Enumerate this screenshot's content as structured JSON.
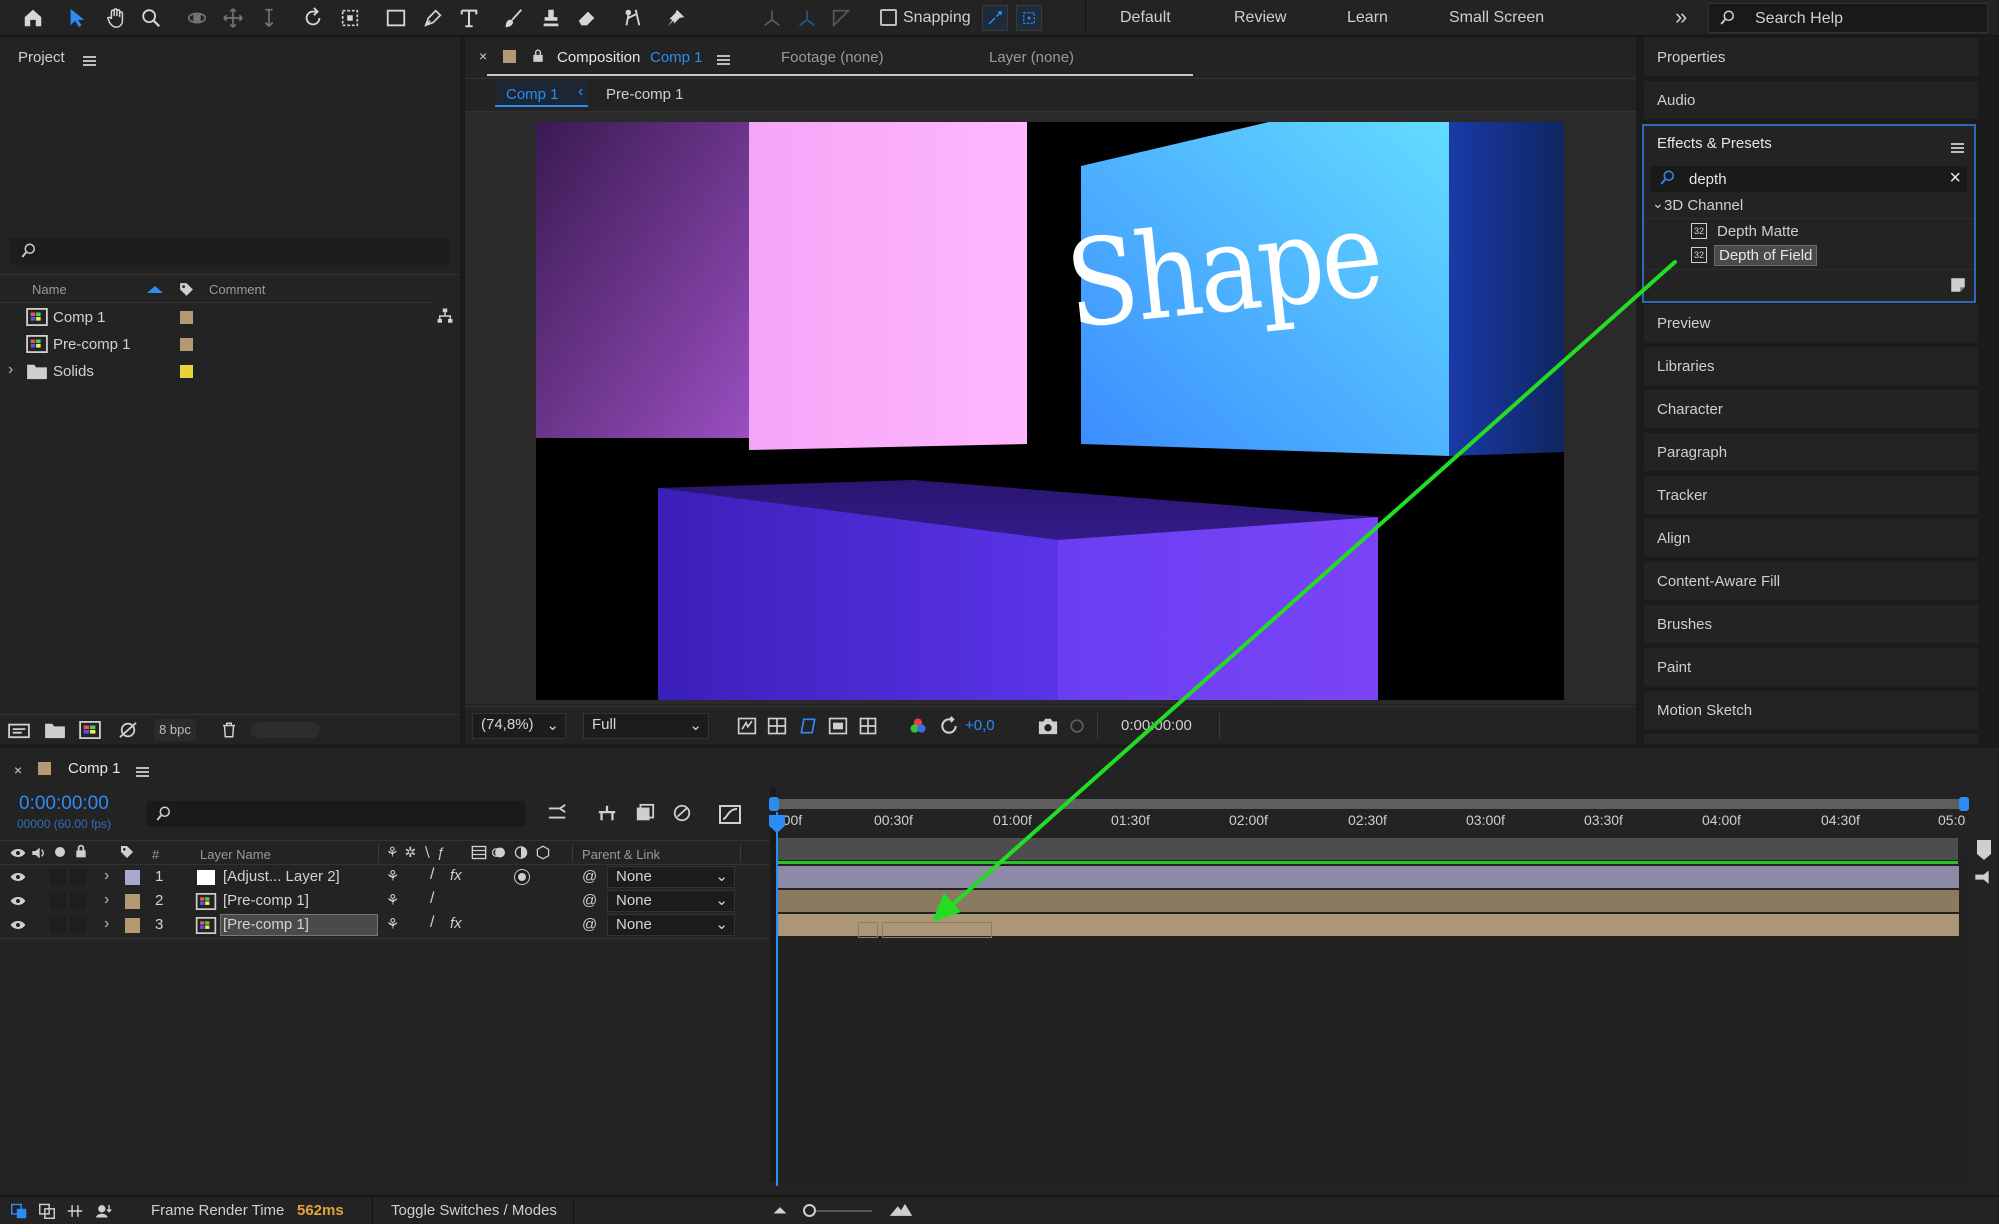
{
  "toolbar": {
    "tools": [
      "home-icon",
      "selection-icon",
      "hand-icon",
      "zoom-icon",
      "orbit-icon",
      "pan-icon",
      "dolly-icon",
      "rotate-icon",
      "camera-icon",
      "rectangle-icon",
      "pen-icon",
      "type-icon",
      "brush-icon",
      "clone-stamp-icon",
      "eraser-icon",
      "roto-brush-icon",
      "puppet-pin-icon"
    ],
    "snapping_label": "Snapping",
    "workspaces": [
      "Default",
      "Review",
      "Learn",
      "Small Screen"
    ],
    "overflow": "»",
    "search_placeholder": "Search Help"
  },
  "project": {
    "title": "Project",
    "search_value": "",
    "columns": {
      "name": "Name",
      "comment": "Comment"
    },
    "items": [
      {
        "name": "Comp 1",
        "type": "composition",
        "color": "#b39a72"
      },
      {
        "name": "Pre-comp 1",
        "type": "composition",
        "color": "#b39a72"
      },
      {
        "name": "Solids",
        "type": "folder",
        "color": "#e7d33a"
      }
    ],
    "bpc": "8 bpc"
  },
  "viewer": {
    "tab_prefix": "Composition",
    "tab_comp": "Comp 1",
    "footage_tab": "Footage (none)",
    "layer_tab": "Layer (none)",
    "breadcrumbs": [
      "Comp 1",
      "Pre-comp 1"
    ],
    "shape_text": "Shape",
    "zoom": "(74,8%)",
    "resolution": "Full",
    "exposure": "+0,0",
    "timecode": "0:00:00:00"
  },
  "right_panels": {
    "properties": "Properties",
    "audio": "Audio",
    "effects_title": "Effects & Presets",
    "effects_search": "depth",
    "category": "3D Channel",
    "effects": [
      "Depth Matte",
      "Depth of Field"
    ],
    "badge": "32",
    "items": [
      "Preview",
      "Libraries",
      "Character",
      "Paragraph",
      "Tracker",
      "Align",
      "Content-Aware Fill",
      "Brushes",
      "Paint",
      "Motion Sketch"
    ]
  },
  "timeline": {
    "title": "Comp 1",
    "timecode": "0:00:00:00",
    "frames": "00000 (60.00 fps)",
    "search_value": "",
    "columns": {
      "hash": "#",
      "layer_name": "Layer Name",
      "parent": "Parent & Link"
    },
    "ticks": [
      "0:00f",
      "00:30f",
      "01:00f",
      "01:30f",
      "02:00f",
      "02:30f",
      "03:00f",
      "03:30f",
      "04:00f",
      "04:30f",
      "05:0"
    ],
    "layers": [
      {
        "num": "1",
        "name": "[Adjust... Layer 2]",
        "label_color": "#a9a9cf",
        "parent": "None",
        "bar_color": "#8c8aa6",
        "selected": false
      },
      {
        "num": "2",
        "name": "[Pre-comp 1]",
        "label_color": "#b39a72",
        "parent": "None",
        "bar_color": "#8a7a60",
        "selected": false
      },
      {
        "num": "3",
        "name": "[Pre-comp 1]",
        "label_color": "#b39a72",
        "parent": "None",
        "bar_color": "#ab9677",
        "selected": true
      }
    ]
  },
  "status": {
    "render_label": "Frame Render Time",
    "render_value": "562ms",
    "toggle": "Toggle Switches / Modes"
  },
  "colors": {
    "accent": "#2c8cf4",
    "arrow": "#22dd22",
    "render_time": "#e6a23c"
  }
}
